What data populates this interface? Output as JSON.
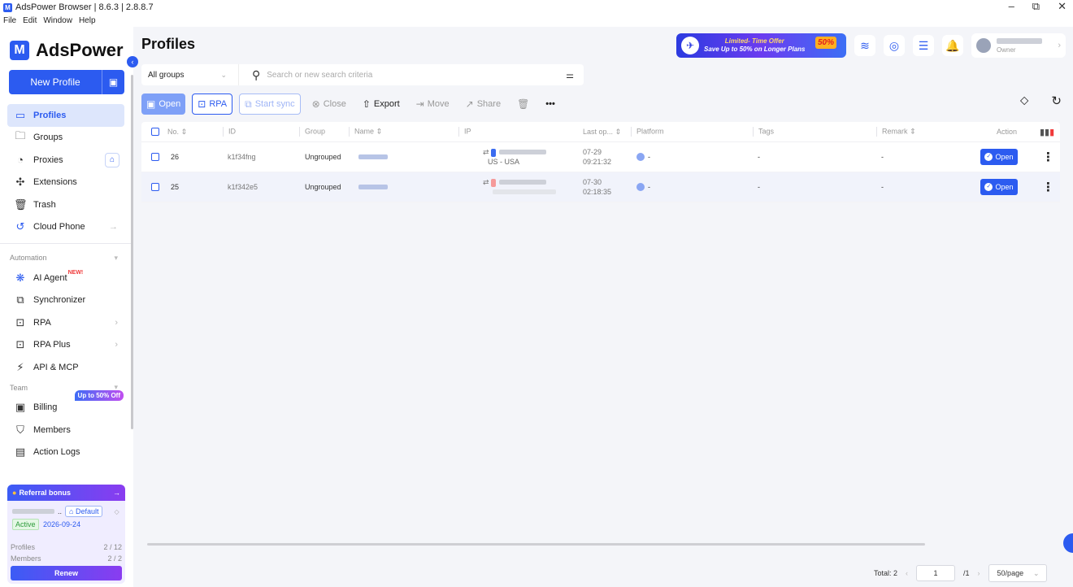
{
  "window": {
    "title": "AdsPower Browser | 8.6.3 | 2.8.8.7",
    "menu": [
      "File",
      "Edit",
      "Window",
      "Help"
    ],
    "controls": {
      "minimize": "–",
      "restore": "⧉",
      "close": "✕"
    }
  },
  "brand": {
    "icon": "M",
    "name": "AdsPower"
  },
  "sidebar": {
    "new_profile_label": "New Profile",
    "items": [
      {
        "label": "Profiles",
        "icon": "window-icon"
      },
      {
        "label": "Groups",
        "icon": "folder-icon"
      },
      {
        "label": "Proxies",
        "icon": "proxy-icon"
      },
      {
        "label": "Extensions",
        "icon": "puzzle-icon"
      },
      {
        "label": "Trash",
        "icon": "trash-icon"
      },
      {
        "label": "Cloud Phone",
        "icon": "cloud-phone-icon"
      }
    ],
    "automation": {
      "heading": "Automation",
      "items": [
        {
          "label": "AI Agent",
          "badge": "NEW!"
        },
        {
          "label": "Synchronizer"
        },
        {
          "label": "RPA"
        },
        {
          "label": "RPA Plus"
        },
        {
          "label": "API & MCP"
        }
      ]
    },
    "team": {
      "heading": "Team",
      "promo": "Up to 50% Off",
      "items": [
        {
          "label": "Billing"
        },
        {
          "label": "Members"
        },
        {
          "label": "Action Logs"
        }
      ]
    },
    "referral": {
      "heading": "Referral bonus",
      "account_suffix": "..",
      "default_tag": "Default",
      "status": "Active",
      "expires": "2026-09-24",
      "profiles_label": "Profiles",
      "profiles_value": "2 / 12",
      "members_label": "Members",
      "members_value": "2 / 2",
      "renew_label": "Renew"
    }
  },
  "header": {
    "title": "Profiles",
    "promo_line1": "Limited- Time Offer",
    "promo_line2": "Save Up to 50% on Longer Plans",
    "promo_badge": "50%",
    "user_role": "Owner"
  },
  "filters": {
    "group_select": "All groups",
    "search_placeholder": "Search or new search criteria"
  },
  "toolbar": {
    "open": "Open",
    "rpa": "RPA",
    "start_sync": "Start sync",
    "close": "Close",
    "export": "Export",
    "move": "Move",
    "share": "Share",
    "more": "•••"
  },
  "table": {
    "columns": [
      "No.",
      "ID",
      "Group",
      "Name",
      "IP",
      "Last op...",
      "Platform",
      "Tags",
      "Remark",
      "Action"
    ],
    "rows": [
      {
        "no": "26",
        "id": "k1f34fng",
        "group": "Ungrouped",
        "ip_country": "US - USA",
        "last_date": "07-29",
        "last_time": "09:21:32",
        "platform": "-",
        "tags": "-",
        "remark": "-",
        "action": "Open",
        "flag_color": "#3b6cf0"
      },
      {
        "no": "25",
        "id": "k1f342e5",
        "group": "Ungrouped",
        "ip_country": "",
        "last_date": "07-30",
        "last_time": "02:18:35",
        "platform": "-",
        "tags": "-",
        "remark": "-",
        "action": "Open",
        "flag_color": "#f59a9a"
      }
    ]
  },
  "pagination": {
    "total": "Total: 2",
    "page": "1",
    "of": "/1",
    "page_size": "50/page"
  },
  "colors": {
    "accent": "#2c5bf0",
    "active_bg": "#dde6fc"
  }
}
